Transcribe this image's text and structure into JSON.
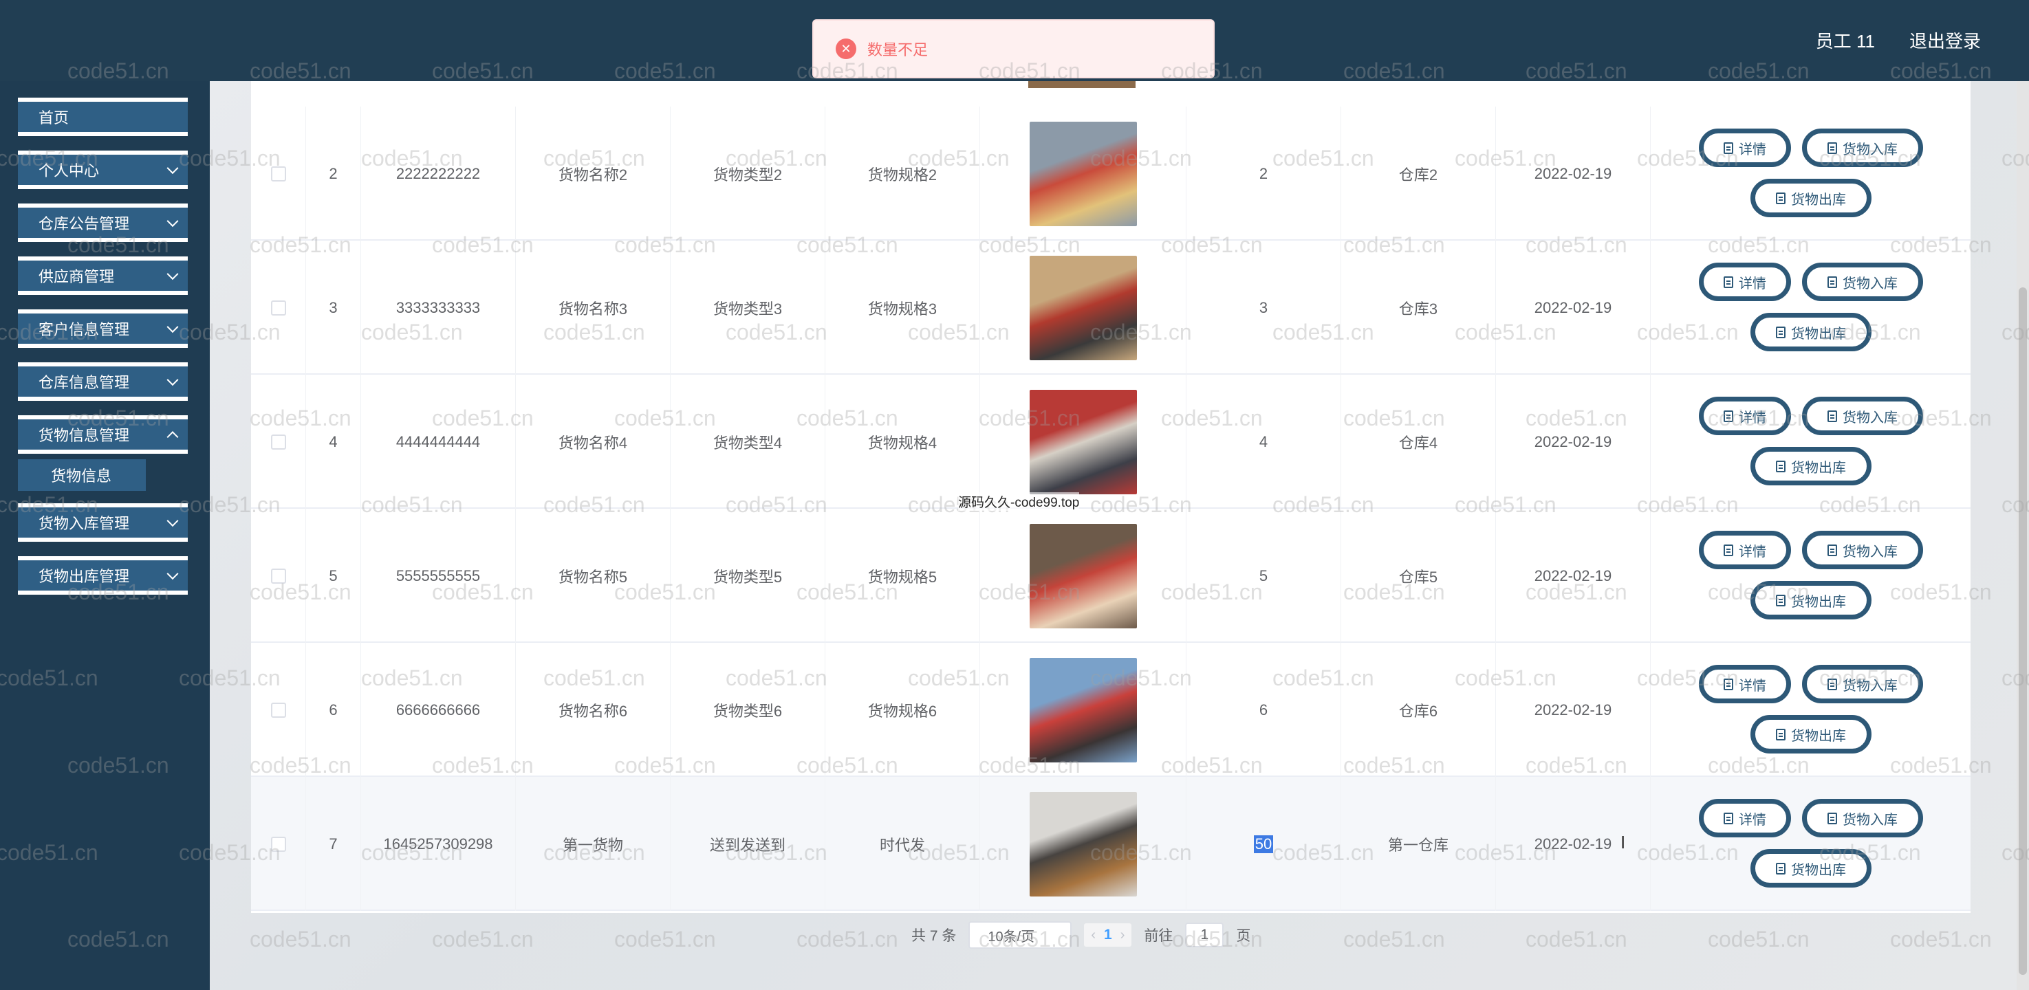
{
  "header": {
    "user_label": "员工 11",
    "logout_label": "退出登录"
  },
  "toast": {
    "icon": "error-icon",
    "message": "数量不足"
  },
  "sidebar": {
    "items": [
      {
        "label": "首页"
      },
      {
        "label": "个人中心"
      },
      {
        "label": "仓库公告管理"
      },
      {
        "label": "供应商管理"
      },
      {
        "label": "客户信息管理"
      },
      {
        "label": "仓库信息管理"
      },
      {
        "label": "货物信息管理"
      },
      {
        "label": "货物入库管理"
      },
      {
        "label": "货物出库管理"
      }
    ],
    "sub_item": "货物信息"
  },
  "table": {
    "rows": [
      {
        "index": "2",
        "code": "2222222222",
        "name": "货物名称2",
        "type": "货物类型2",
        "spec": "货物规格2",
        "qty": "2",
        "warehouse": "仓库2",
        "date": "2022-02-19"
      },
      {
        "index": "3",
        "code": "3333333333",
        "name": "货物名称3",
        "type": "货物类型3",
        "spec": "货物规格3",
        "qty": "3",
        "warehouse": "仓库3",
        "date": "2022-02-19"
      },
      {
        "index": "4",
        "code": "4444444444",
        "name": "货物名称4",
        "type": "货物类型4",
        "spec": "货物规格4",
        "qty": "4",
        "warehouse": "仓库4",
        "date": "2022-02-19"
      },
      {
        "index": "5",
        "code": "5555555555",
        "name": "货物名称5",
        "type": "货物类型5",
        "spec": "货物规格5",
        "qty": "5",
        "warehouse": "仓库5",
        "date": "2022-02-19"
      },
      {
        "index": "6",
        "code": "6666666666",
        "name": "货物名称6",
        "type": "货物类型6",
        "spec": "货物规格6",
        "qty": "6",
        "warehouse": "仓库6",
        "date": "2022-02-19"
      },
      {
        "index": "7",
        "code": "1645257309298",
        "name": "第一货物",
        "type": "送到发送到",
        "spec": "时代发",
        "qty": "50",
        "warehouse": "第一仓库",
        "date": "2022-02-19"
      }
    ],
    "actions": {
      "detail": "详情",
      "inbound": "货物入库",
      "outbound": "货物出库"
    }
  },
  "pagination": {
    "total": "共 7 条",
    "page_size": "10条/页",
    "current_page": "1",
    "goto_prefix": "前往",
    "goto_value": "1",
    "goto_suffix": "页"
  },
  "watermark": "code51.cn",
  "center_note": "源码久久-code99.top"
}
